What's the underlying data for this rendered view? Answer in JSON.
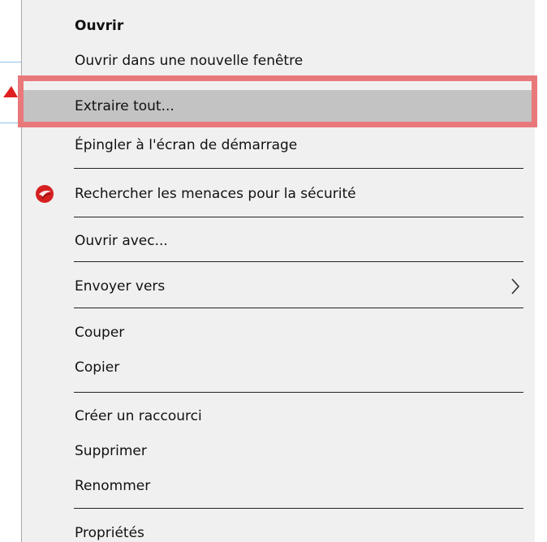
{
  "menu": {
    "items": [
      {
        "label": "Ouvrir"
      },
      {
        "label": "Ouvrir dans une nouvelle fenêtre"
      },
      {
        "label": "Extraire tout..."
      },
      {
        "label": "Épingler à l'écran de démarrage"
      },
      {
        "label": "Rechercher les menaces pour la sécurité",
        "icon": "trend-micro-icon"
      },
      {
        "label": "Ouvrir avec..."
      },
      {
        "label": "Envoyer vers",
        "icon": "chevron-right-icon"
      },
      {
        "label": "Couper"
      },
      {
        "label": "Copier"
      },
      {
        "label": "Créer un raccourci"
      },
      {
        "label": "Supprimer"
      },
      {
        "label": "Renommer"
      },
      {
        "label": "Propriétés"
      }
    ],
    "highlighted_item": "Extraire tout..."
  },
  "colors": {
    "menu_background": "#f0f0f0",
    "highlight_row": "#c3c3c3",
    "annotation_box": "#e8787a",
    "annotation_arrow": "#e02020",
    "icon_red": "#d62020"
  }
}
